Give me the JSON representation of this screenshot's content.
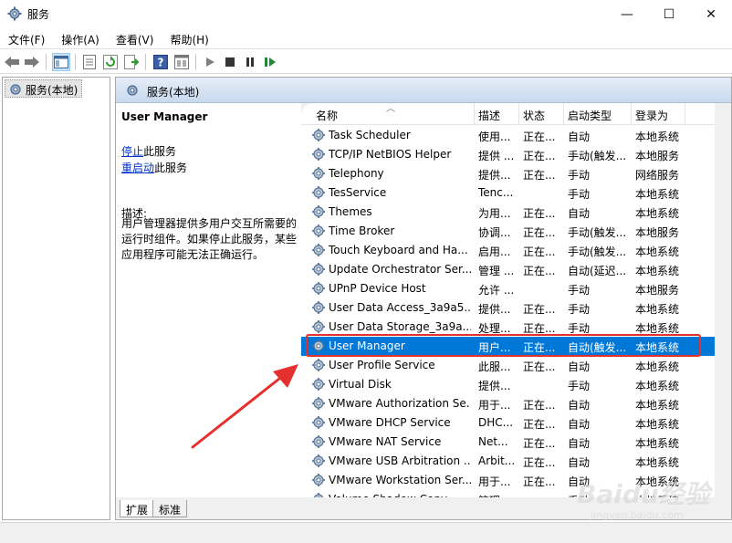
{
  "window": {
    "title": "服务",
    "buttons": {
      "minimize": "—",
      "maximize": "☐",
      "close": "✕"
    }
  },
  "menu": [
    "文件(F)",
    "操作(A)",
    "查看(V)",
    "帮助(H)"
  ],
  "tree": {
    "item": "服务(本地)"
  },
  "pane": {
    "title": "服务(本地)",
    "selected_name": "User Manager",
    "stop_link": "停止",
    "stop_suffix": "此服务",
    "restart_link": "重启动",
    "restart_suffix": "此服务",
    "desc_label": "描述:",
    "desc_text": "用户管理器提供多用户交互所需要的运行时组件。如果停止此服务，某些应用程序可能无法正确运行。"
  },
  "columns": {
    "name": "名称",
    "desc": "描述",
    "status": "状态",
    "start": "启动类型",
    "logon": "登录为"
  },
  "rows": [
    {
      "name": "Task Scheduler",
      "desc": "使用...",
      "status": "正在...",
      "start": "自动",
      "logon": "本地系统"
    },
    {
      "name": "TCP/IP NetBIOS Helper",
      "desc": "提供 ...",
      "status": "正在...",
      "start": "手动(触发...",
      "logon": "本地服务"
    },
    {
      "name": "Telephony",
      "desc": "提供...",
      "status": "正在...",
      "start": "手动",
      "logon": "网络服务"
    },
    {
      "name": "TesService",
      "desc": "Tenc...",
      "status": "",
      "start": "手动",
      "logon": "本地系统"
    },
    {
      "name": "Themes",
      "desc": "为用...",
      "status": "正在...",
      "start": "自动",
      "logon": "本地系统"
    },
    {
      "name": "Time Broker",
      "desc": "协调...",
      "status": "正在...",
      "start": "手动(触发...",
      "logon": "本地服务"
    },
    {
      "name": "Touch Keyboard and Ha...",
      "desc": "启用...",
      "status": "正在...",
      "start": "手动(触发...",
      "logon": "本地系统"
    },
    {
      "name": "Update Orchestrator Ser...",
      "desc": "管理 ...",
      "status": "正在...",
      "start": "自动(延迟...",
      "logon": "本地系统"
    },
    {
      "name": "UPnP Device Host",
      "desc": "允许 ...",
      "status": "",
      "start": "手动",
      "logon": "本地服务"
    },
    {
      "name": "User Data Access_3a9a5...",
      "desc": "提供...",
      "status": "正在...",
      "start": "手动",
      "logon": "本地系统"
    },
    {
      "name": "User Data Storage_3a9a...",
      "desc": "处理...",
      "status": "正在...",
      "start": "手动",
      "logon": "本地系统"
    },
    {
      "name": "User Manager",
      "desc": "用户...",
      "status": "正在...",
      "start": "自动(触发...",
      "logon": "本地系统",
      "selected": true
    },
    {
      "name": "User Profile Service",
      "desc": "此服...",
      "status": "正在...",
      "start": "自动",
      "logon": "本地系统"
    },
    {
      "name": "Virtual Disk",
      "desc": "提供...",
      "status": "",
      "start": "手动",
      "logon": "本地系统"
    },
    {
      "name": "VMware Authorization Se...",
      "desc": "用于...",
      "status": "正在...",
      "start": "自动",
      "logon": "本地系统"
    },
    {
      "name": "VMware DHCP Service",
      "desc": "DHC...",
      "status": "正在...",
      "start": "自动",
      "logon": "本地系统"
    },
    {
      "name": "VMware NAT Service",
      "desc": "Net...",
      "status": "正在...",
      "start": "自动",
      "logon": "本地系统"
    },
    {
      "name": "VMware USB Arbitration ...",
      "desc": "Arbit...",
      "status": "正在...",
      "start": "自动",
      "logon": "本地系统"
    },
    {
      "name": "VMware Workstation Ser...",
      "desc": "用于...",
      "status": "正在...",
      "start": "自动",
      "logon": "本地系统"
    },
    {
      "name": "Volume Shadow Copy",
      "desc": "管理...",
      "status": "",
      "start": "手动",
      "logon": "本地系统"
    }
  ],
  "tabs": [
    "扩展",
    "标准"
  ],
  "watermark": {
    "main": "Baidu经验",
    "sub": "jingyan.baidu.com"
  },
  "colors": {
    "selection": "#0078d7",
    "highlight_box": "#e53030",
    "arrow": "#e53030",
    "link": "#0033cc"
  },
  "icons": [
    "services-gear-icon",
    "back-arrow-icon",
    "forward-arrow-icon",
    "console-tree-icon",
    "properties-icon",
    "refresh-icon",
    "export-list-icon",
    "help-icon",
    "view-icon",
    "start-icon",
    "stop-icon",
    "pause-icon",
    "restart-icon"
  ]
}
